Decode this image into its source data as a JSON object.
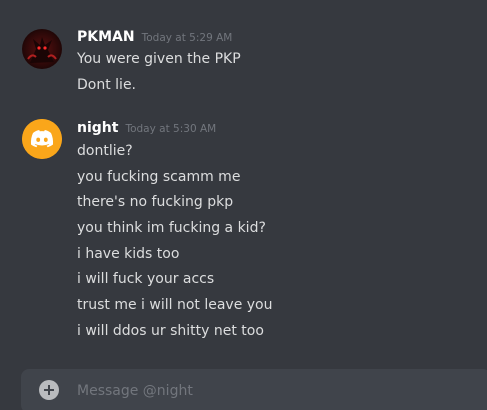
{
  "messages": [
    {
      "username": "PKMAN",
      "timestamp": "Today at 5:29 AM",
      "avatar_icon": "dark-red-demon-avatar-icon",
      "lines": [
        "You were given the PKP",
        "Dont lie."
      ]
    },
    {
      "username": "night",
      "timestamp": "Today at 5:30 AM",
      "avatar_icon": "discord-logo-avatar-icon",
      "lines": [
        "dontlie?",
        "you fucking scamm me",
        "there's no fucking pkp",
        "you think im fucking a kid?",
        "i have kids too",
        "i will fuck your accs",
        "trust me i will not leave you",
        "i will ddos ur shitty net too"
      ]
    }
  ],
  "composer": {
    "placeholder": "Message @night"
  },
  "colors": {
    "background": "#36393f",
    "composer_background": "#40444b",
    "username": "#ffffff",
    "message_text": "#dcddde",
    "timestamp": "#72767d",
    "discord_avatar": "#faa61a"
  }
}
